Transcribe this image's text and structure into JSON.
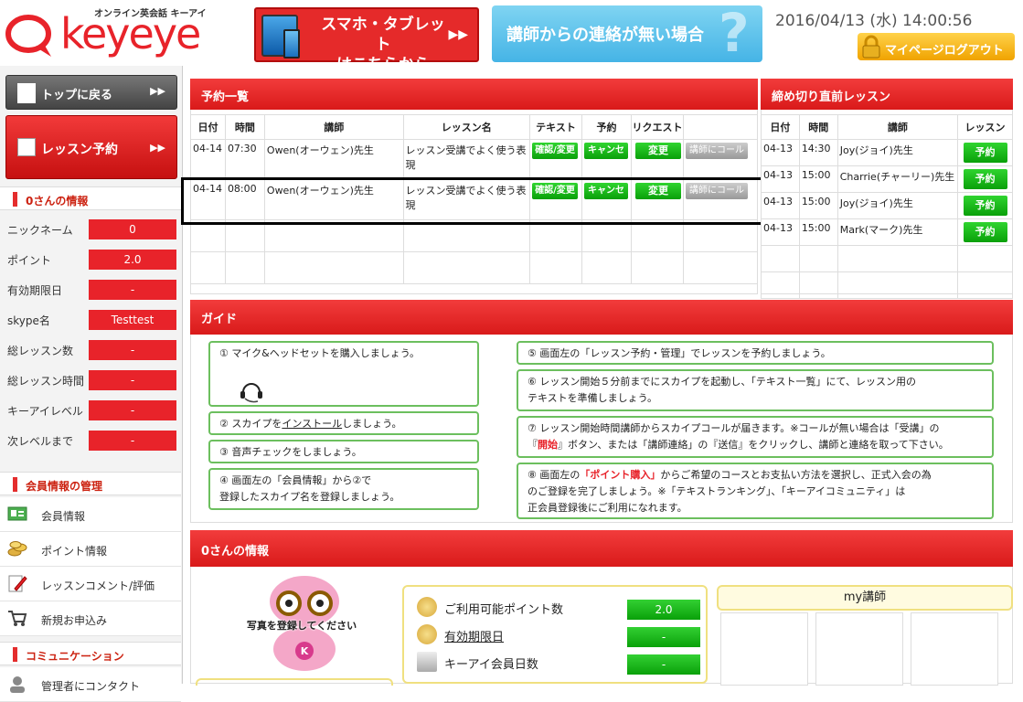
{
  "header": {
    "logo_text": "keyeye",
    "logo_sub": "オンライン英会話 キーアイ",
    "banner_smartphone": "スマホ・タブレット\nはこちらから",
    "banner_contact": "講師からの連絡が無い場合",
    "datetime": "2016/04/13 (水) 14:00:56",
    "logout_label": "マイページログアウト"
  },
  "sidebar": {
    "top_button": "トップに戻る",
    "reserve_button": "レッスン予約",
    "user_info_title": "0さんの情報",
    "user_info": [
      {
        "label": "ニックネーム",
        "value": "0"
      },
      {
        "label": "ポイント",
        "value": "2.0"
      },
      {
        "label": "有効期限日",
        "value": "-"
      },
      {
        "label": "skype名",
        "value": "Testtest"
      },
      {
        "label": "総レッスン数",
        "value": "-"
      },
      {
        "label": "総レッスン時間",
        "value": "-"
      },
      {
        "label": "キーアイレベル",
        "value": "-"
      },
      {
        "label": "次レベルまで",
        "value": "-"
      }
    ],
    "member_title": "会員情報の管理",
    "member_menu": [
      {
        "label": "会員情報",
        "icon": "member-card-icon"
      },
      {
        "label": "ポイント情報",
        "icon": "coins-icon"
      },
      {
        "label": "レッスンコメント/評価",
        "icon": "pencil-icon"
      },
      {
        "label": "新規お申込み",
        "icon": "cart-icon"
      }
    ],
    "community_title": "コミュニケーション",
    "community_menu": [
      {
        "label": "管理者にコンタクト",
        "icon": "contact-icon"
      }
    ]
  },
  "reservations": {
    "title": "予約一覧",
    "columns": [
      "日付",
      "時間",
      "講師",
      "レッスン名",
      "テキスト",
      "予約",
      "リクエスト"
    ],
    "rows": [
      {
        "date": "04-14",
        "time": "07:30",
        "teacher": "Owen(オーウェン)先生",
        "lesson": "レッスン受講でよく使う表現",
        "text_btn": "確認/変更",
        "cancel_btn": "キャンセル",
        "change_btn": "変更",
        "call_btn": "講師にコール"
      },
      {
        "date": "04-14",
        "time": "08:00",
        "teacher": "Owen(オーウェン)先生",
        "lesson": "レッスン受講でよく使う表現",
        "text_btn": "確認/変更",
        "cancel_btn": "キャンセル",
        "change_btn": "変更",
        "call_btn": "講師にコール"
      }
    ]
  },
  "deadline": {
    "title": "締め切り直前レッスン",
    "columns": [
      "日付",
      "時間",
      "講師",
      "レッスン"
    ],
    "rows": [
      {
        "date": "04-13",
        "time": "14:30",
        "teacher": "Joy(ジョイ)先生",
        "btn": "予約"
      },
      {
        "date": "04-13",
        "time": "15:00",
        "teacher": "Charrie(チャーリー)先生",
        "btn": "予約"
      },
      {
        "date": "04-13",
        "time": "15:00",
        "teacher": "Joy(ジョイ)先生",
        "btn": "予約"
      },
      {
        "date": "04-13",
        "time": "15:00",
        "teacher": "Mark(マーク)先生",
        "btn": "予約"
      }
    ]
  },
  "guide": {
    "title": "ガイド",
    "step1": "① マイク&ヘッドセットを購入しましょう。",
    "step2_pre": "② スカイプを",
    "step2_link": "インストール",
    "step2_post": "しましょう。",
    "step3": "③ 音声チェックをしましょう。",
    "step4_l1": "④ 画面左の「会員情報」から②で",
    "step4_l2": "登録したスカイプ名を登録しましょう。",
    "step5": "⑤ 画面左の「レッスン予約・管理」でレッスンを予約しましょう。",
    "step6_l1": "⑥ レッスン開始５分前までにスカイプを起動し、「テキスト一覧」にて、レッスン用の",
    "step6_l2": "テキストを準備しましょう。",
    "step7_l1": "⑦ レッスン開始時間講師からスカイプコールが届きます。※コールが無い場合は「受講」の",
    "step7_l2a": "『",
    "step7_l2b": "開始",
    "step7_l2c": "』ボタン、または「講師連絡」の『送信』をクリックし、講師と連絡を取って下さい。",
    "step8_l1a": "⑧ 画面左の",
    "step8_l1b": "「ポイント購入」",
    "step8_l1c": "からご希望のコースとお支払い方法を選択し、正式入会の為",
    "step8_l2": "のご登録を完了しましょう。※「テキストランキング」、「キーアイコミュニティ」は",
    "step8_l3": "正会員登録後にご利用になれます。"
  },
  "user_panel": {
    "title": "0さんの情報",
    "photo_caption": "写真を登録してください",
    "mascot_letter": "K",
    "points": [
      {
        "label": "ご利用可能ポイント数",
        "value": "2.0"
      },
      {
        "label": "有効期限日",
        "value": "-"
      },
      {
        "label": "キーアイ会員日数",
        "value": "-"
      }
    ],
    "my_teacher_title": "my講師"
  },
  "colors": {
    "brand_red": "#e8232a",
    "button_green": "#0aa00a",
    "guide_border": "#6cbf5e"
  }
}
